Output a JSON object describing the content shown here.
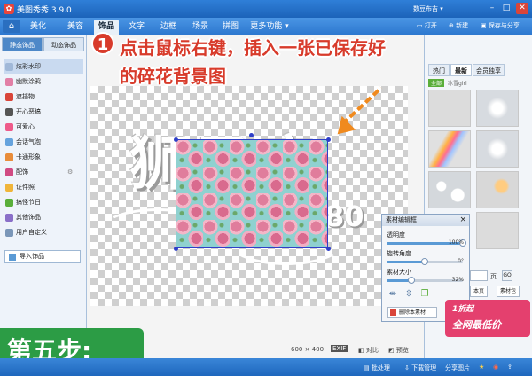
{
  "titlebar": {
    "app_title": "美图秀秀  3.9.0",
    "account": "数豆布吉 ▾",
    "min": "–",
    "max": "□",
    "close": "✕"
  },
  "tabs": [
    "美化",
    "美容",
    "饰品",
    "文字",
    "边框",
    "场景",
    "拼图",
    "更多功能 ▾"
  ],
  "actions": {
    "open": "打开",
    "new": "新建",
    "save": "保存与分享"
  },
  "sidebar": {
    "tabs": [
      "静态饰品",
      "动态饰品"
    ],
    "items": [
      "炫彩水印",
      "幽默涂鸦",
      "遮挡物",
      "开心恶搞",
      "可爱心",
      "会话气泡",
      "卡通形象",
      "配饰",
      "证件照",
      "搞怪节日",
      "其他饰品",
      "用户自定义"
    ],
    "import": "导入饰品"
  },
  "canvas": {
    "big_text": "狮子座",
    "num_text": "80",
    "size": "600 × 400",
    "exif": "EXIF",
    "compare": "对比",
    "preview": "预览"
  },
  "annotation": {
    "number": "1",
    "line1": "点击鼠标右键，插入一张已保存好",
    "line2": "的碎花背景图"
  },
  "right_panel": {
    "tabs": [
      "热门",
      "最新",
      "会员独享"
    ],
    "all": "全部",
    "category": "冰雪girl",
    "page_suffix": "页",
    "go": "GO",
    "btn_local": "本页",
    "btn_material": "素材包"
  },
  "dialog": {
    "title": "素材编辑框",
    "opacity_label": "透明度",
    "opacity_value": "100%",
    "rotate_label": "旋转角度",
    "rotate_value": "0°",
    "size_label": "素材大小",
    "size_value": "32%",
    "delete": "删除本素材"
  },
  "promo": {
    "top": "1折起",
    "bottom": "全网最低价"
  },
  "step": "第五步:",
  "bottombar": {
    "batch": "批处理",
    "download": "下载管理",
    "share": "分享图片"
  },
  "levels": {
    "opacity": 1.0,
    "rotate_fraction": 0.5,
    "size": 0.32
  },
  "colors": {
    "accent": "#2d78cf",
    "annotation": "#d83b2b",
    "arrow": "#f08a1e",
    "step": "#2c9c45"
  }
}
